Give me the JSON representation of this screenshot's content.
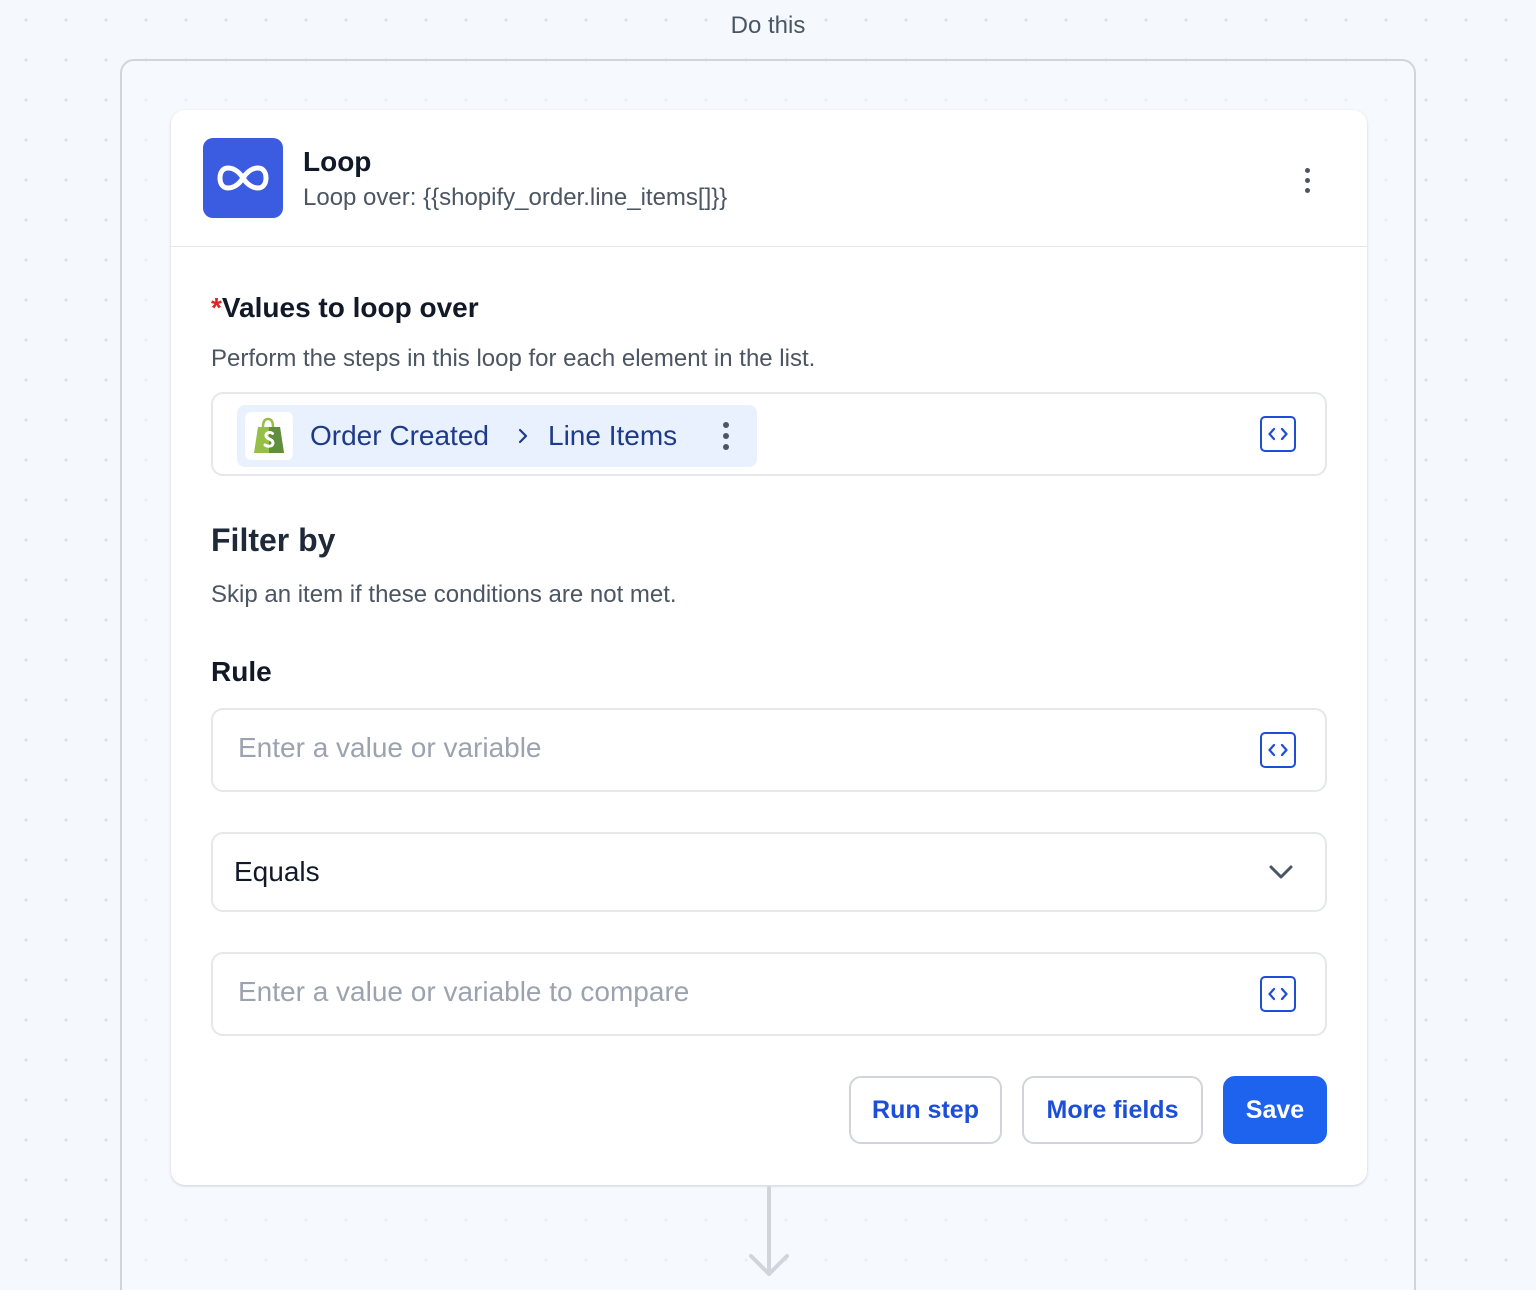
{
  "canvas": {
    "step_group_label": "Do this"
  },
  "step": {
    "title": "Loop",
    "subtitle": "Loop over: {{shopify_order.line_items[]}}",
    "icon": "infinity-icon",
    "icon_bg_color": "#3b5be0"
  },
  "loop_values": {
    "required_marker": "*",
    "label": "Values to loop over",
    "help": "Perform the steps in this loop for each element in the list.",
    "variable_pill": {
      "source_icon": "shopify-icon",
      "source": "Order Created",
      "separator_icon": "chevron-right-icon",
      "field": "Line Items"
    }
  },
  "filter": {
    "heading": "Filter by",
    "help": "Skip an item if these conditions are not met.",
    "rule_label": "Rule",
    "value_input": {
      "value": "",
      "placeholder": "Enter a value or variable"
    },
    "operator": {
      "selected": "Equals"
    },
    "compare_input": {
      "value": "",
      "placeholder": "Enter a value or variable to compare"
    }
  },
  "actions": {
    "run_step": "Run step",
    "more_fields": "More fields",
    "save": "Save"
  },
  "colors": {
    "accent": "#1d63ed",
    "link": "#1d4ed8",
    "pill_bg": "#e8f1fd",
    "required": "#dc2626"
  }
}
